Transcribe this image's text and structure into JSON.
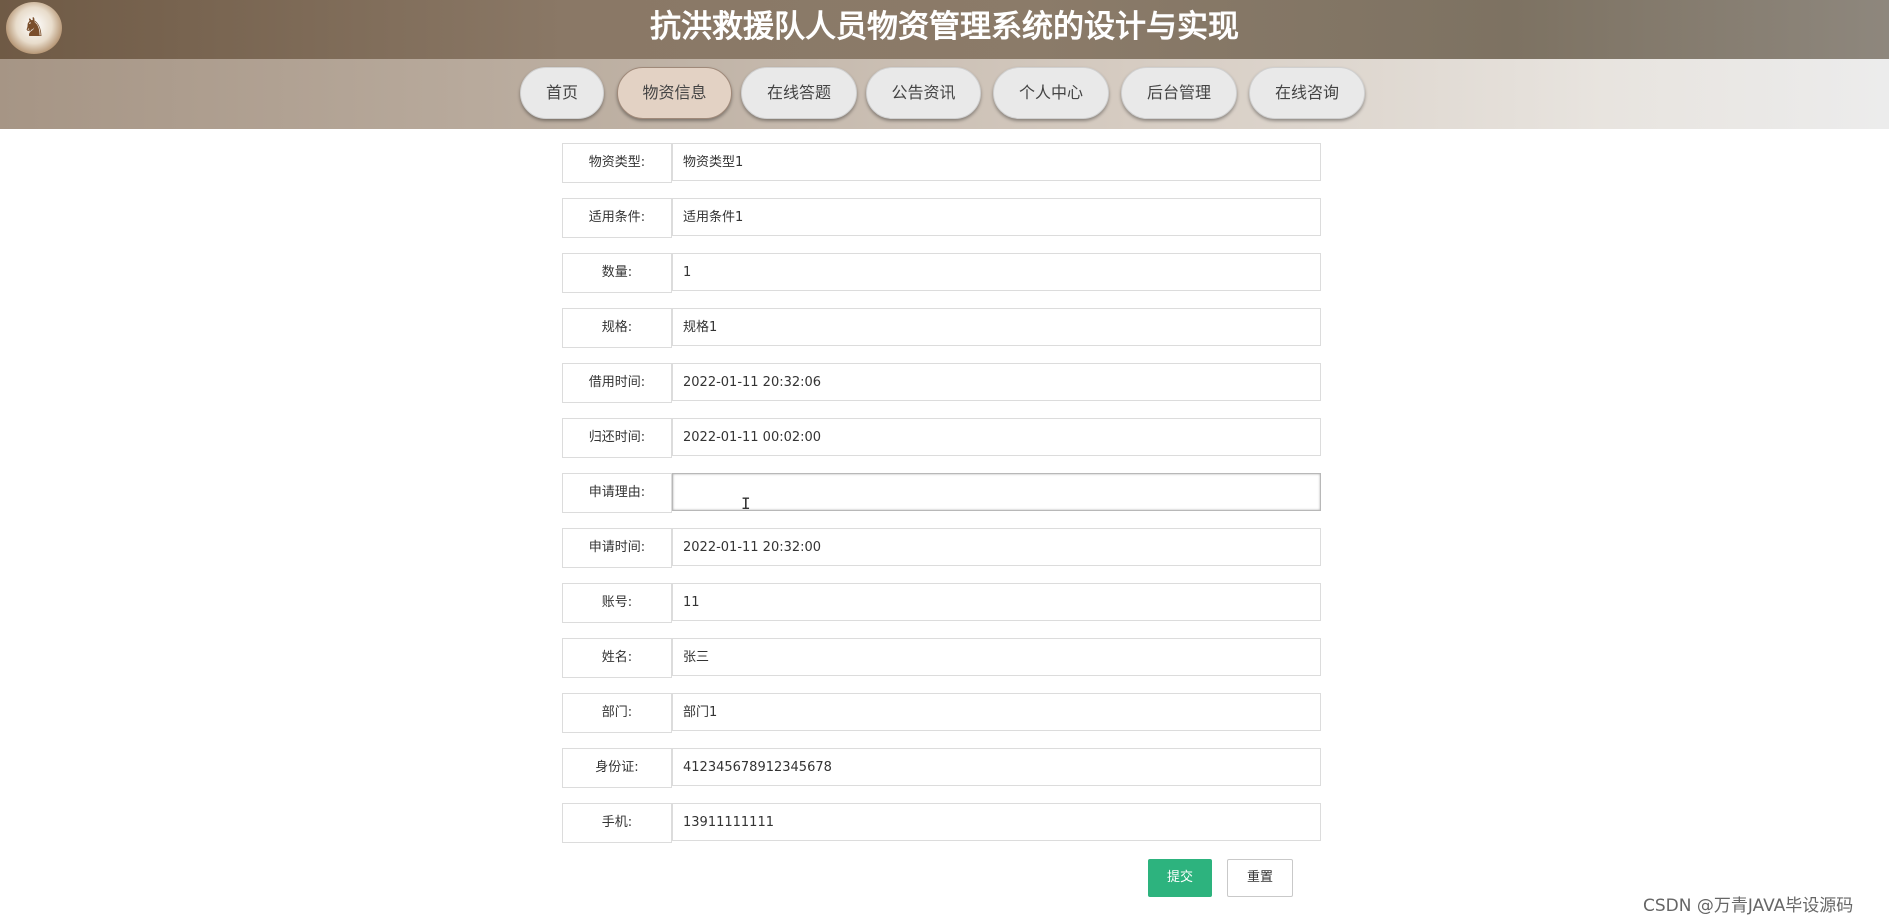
{
  "header": {
    "title": "抗洪救援队人员物资管理系统的设计与实现",
    "logo_icon": "logo-icon"
  },
  "nav": {
    "items": [
      {
        "label": "首页"
      },
      {
        "label": "物资信息"
      },
      {
        "label": "在线答题"
      },
      {
        "label": "公告资讯"
      },
      {
        "label": "个人中心"
      },
      {
        "label": "后台管理"
      },
      {
        "label": "在线咨询"
      }
    ],
    "active": "物资信息"
  },
  "form": {
    "rows": [
      {
        "label": "物资类型:",
        "value": "物资类型1"
      },
      {
        "label": "适用条件:",
        "value": "适用条件1"
      },
      {
        "label": "数量:",
        "value": "1"
      },
      {
        "label": "规格:",
        "value": "规格1"
      },
      {
        "label": "借用时间:",
        "value": "2022-01-11 20:32:06"
      },
      {
        "label": "归还时间:",
        "value": "2022-01-11 00:02:00"
      },
      {
        "label": "申请理由:",
        "value": ""
      },
      {
        "label": "申请时间:",
        "value": "2022-01-11 20:32:00"
      },
      {
        "label": "账号:",
        "value": "11"
      },
      {
        "label": "姓名:",
        "value": "张三"
      },
      {
        "label": "部门:",
        "value": "部门1"
      },
      {
        "label": "身份证:",
        "value": "412345678912345678"
      },
      {
        "label": "手机:",
        "value": "13911111111"
      }
    ],
    "submit_label": "提交",
    "reset_label": "重置"
  },
  "watermark": "CSDN @万青JAVA毕设源码",
  "colors": {
    "header_brown": "#7b6651",
    "submit_green": "#2db37e",
    "active_tab": "#e3d2c4"
  }
}
